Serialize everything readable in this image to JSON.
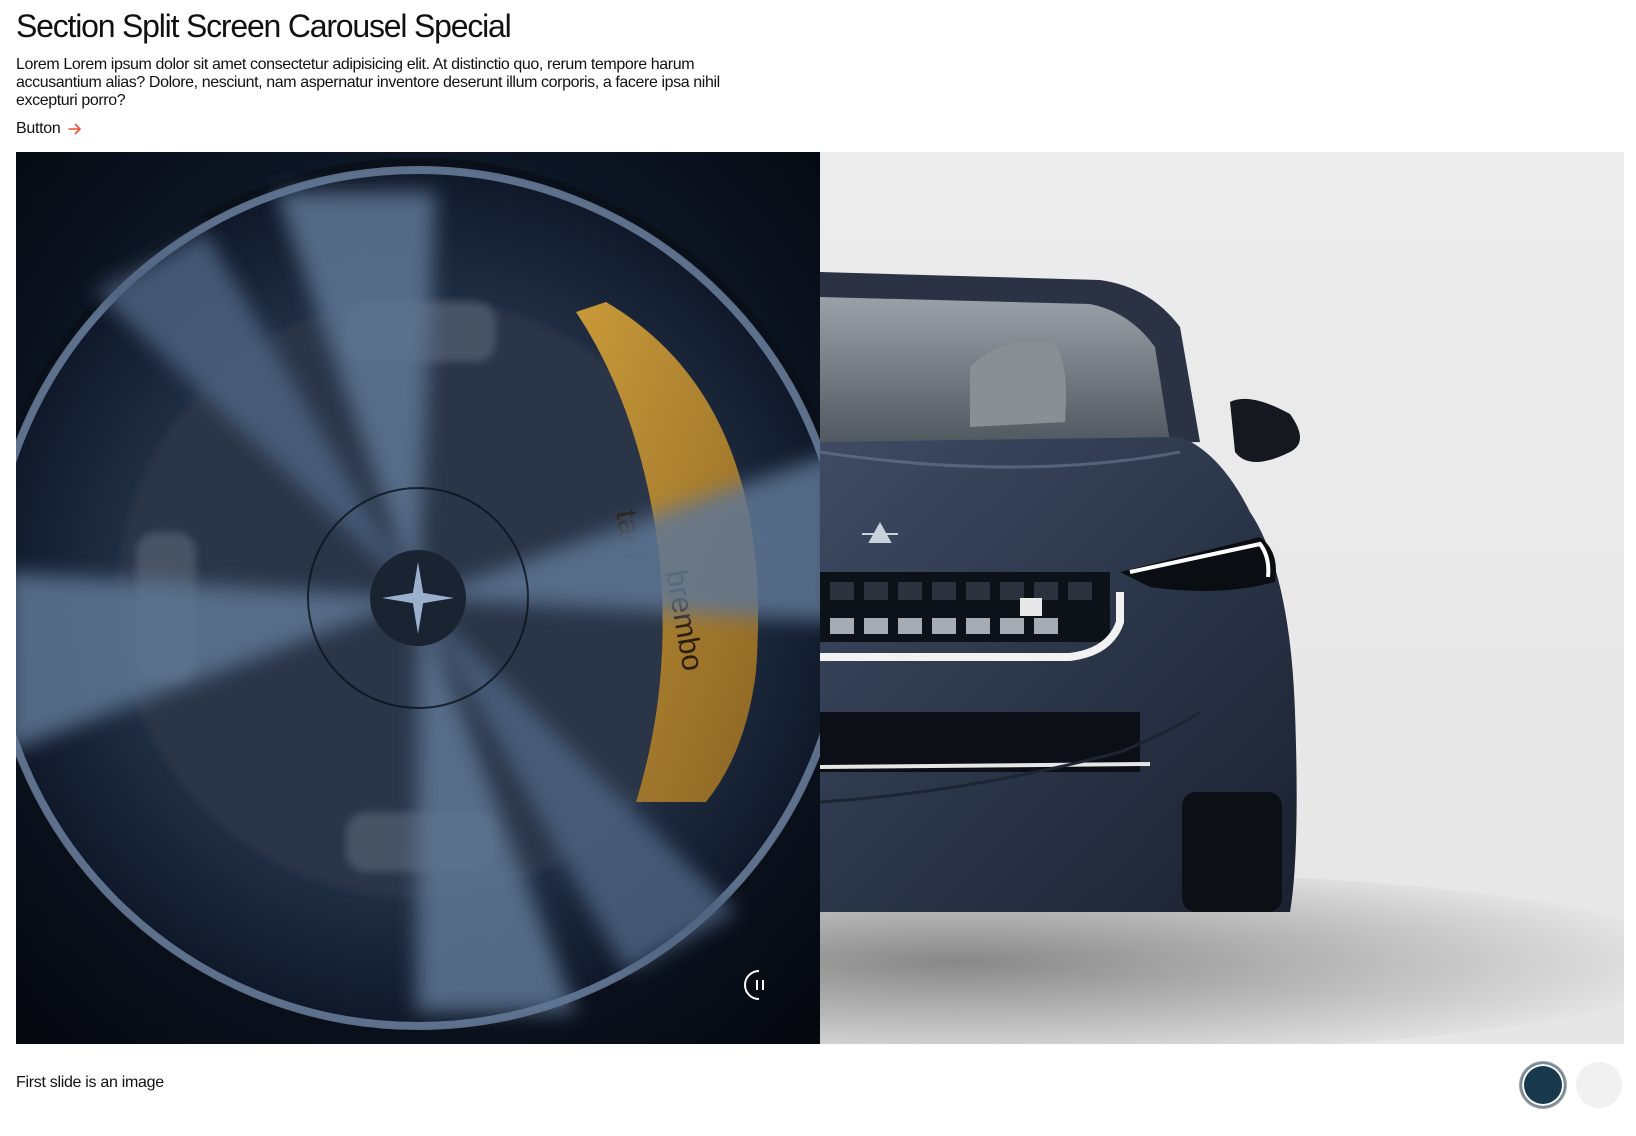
{
  "section": {
    "title": "Section Split Screen Carousel Special",
    "description": "Lorem Lorem ipsum dolor sit amet consectetur adipisicing elit. At distinctio quo, rerum tempore harum accusantium alias? Dolore, nesciunt, nam aspernatur inventore deserunt illum corporis, a facere ipsa nihil excepturi porro?",
    "button_label": "Button",
    "button_icon": "arrow-right-icon"
  },
  "carousel": {
    "left_slide": {
      "icon": "spinning-wheel-image",
      "brake_text": "brembo",
      "brand_fragment": "tar /"
    },
    "right_slide": {
      "icon": "car-front-image"
    },
    "pause_icon": "pause-icon",
    "caption": "First slide is an image",
    "dots": [
      {
        "color": "#18384d",
        "active": true
      },
      {
        "color": "#f1f1f1",
        "active": false
      }
    ]
  },
  "colors": {
    "accent": "#e8542c",
    "text": "#111111",
    "dark_slide_bg": "#0e1624",
    "light_slide_bg": "#ececec"
  }
}
